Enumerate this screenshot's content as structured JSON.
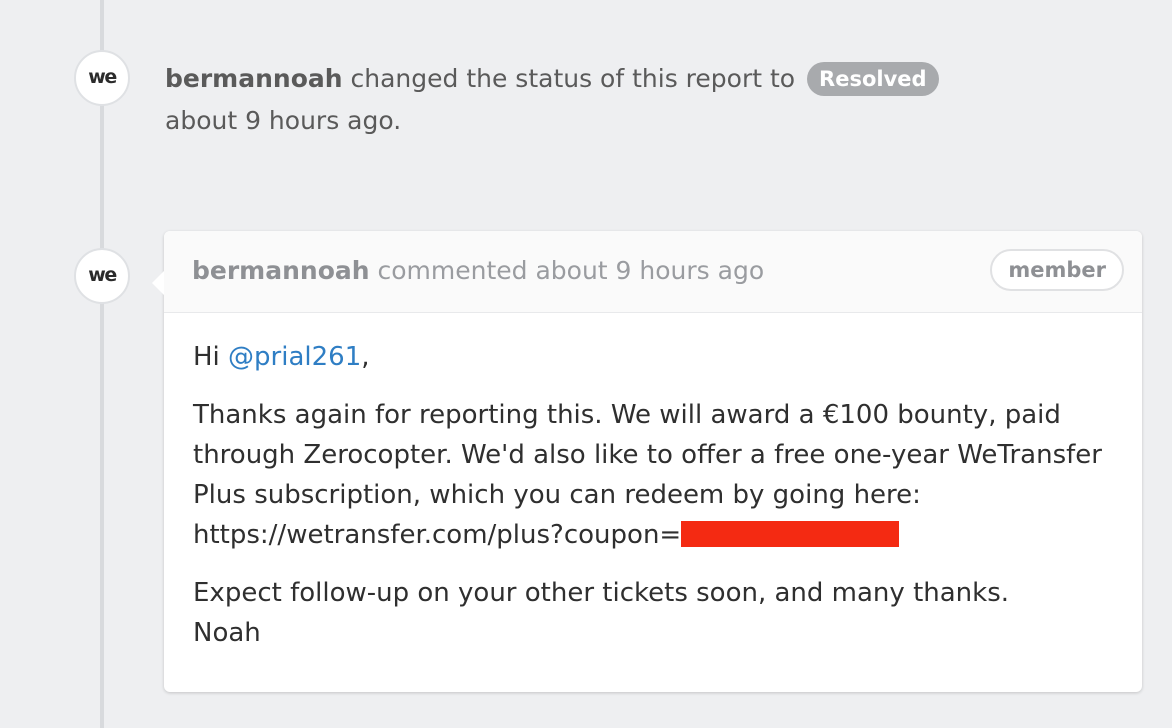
{
  "status_event": {
    "user": "bermannoah",
    "action_text": "changed the status of this report to",
    "status": "Resolved",
    "time": "about 9 hours ago."
  },
  "comment": {
    "user": "bermannoah",
    "action_text": "commented about 9 hours ago",
    "role_badge": "member",
    "greeting_prefix": "Hi",
    "mention": "@prial261",
    "greeting_suffix": ",",
    "paragraph_1": "Thanks again for reporting this. We will award a €100 bounty, paid through Zerocopter. We'd also like to offer a free one-year WeTransfer Plus subscription, which you can redeem by going here: https://wetransfer.com/plus?coupon=",
    "paragraph_2_line_1": "Expect follow-up on your other tickets soon, and many thanks.",
    "paragraph_2_line_2": "Noah"
  },
  "avatar_logo": "we",
  "colors": {
    "mention": "#2f7ec4",
    "status_badge_bg": "#a8aaad",
    "redaction": "#f42a12",
    "background": "#eeeff1"
  }
}
